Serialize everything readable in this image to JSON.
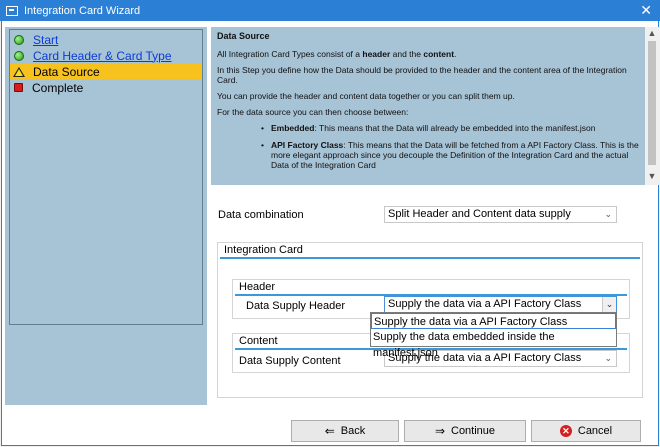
{
  "window": {
    "title": "Integration Card Wizard",
    "close_glyph": "✕"
  },
  "steps": [
    {
      "label": "Start",
      "state": "done",
      "icon": "green-dot-icon"
    },
    {
      "label": "Card Header & Card Type",
      "state": "done",
      "icon": "green-dot-icon"
    },
    {
      "label": "Data Source",
      "state": "current",
      "icon": "warning-icon"
    },
    {
      "label": "Complete",
      "state": "pending",
      "icon": "red-square-icon"
    }
  ],
  "info": {
    "heading": "Data Source",
    "p1_pre": "All Integration Card Types consist of a ",
    "p1_b1": "header",
    "p1_mid": " and the ",
    "p1_b2": "content",
    "p1_end": ".",
    "p2": "In this Step you define how the Data should be provided to the header and the content area of the Integration Card.",
    "p3": "You can provide the header and content data together or you can split them up.",
    "p4": "For the data source you can then choose between:",
    "bullet1_b": "Embedded",
    "bullet1": ": This means that the Data will already be embedded into the manifest.json",
    "bullet2_b": "API Factory Class",
    "bullet2": ": This means that the Data will be fetched from a API Factory Class. This is the more elegant approach since you decouple the Definition of the Integration Card and the actual Data of the Integration Card"
  },
  "form": {
    "data_combination_label": "Data combination",
    "data_combination_value": "Split Header and Content data supply",
    "integration_card_title": "Integration Card",
    "header_group_title": "Header",
    "data_supply_header_label": "Data Supply Header",
    "data_supply_header_value": "Supply the data via a API Factory Class",
    "header_options": [
      "Supply the data via a API Factory Class",
      "Supply the data embedded inside the manifest.json"
    ],
    "content_group_title": "Content",
    "data_supply_content_label": "Data Supply Content",
    "data_supply_content_value": "Supply the data via a API Factory Class"
  },
  "buttons": {
    "back": "Back",
    "continue": "Continue",
    "cancel": "Cancel"
  },
  "colors": {
    "titlebar": "#2b7fd4",
    "panel": "#a7c3d6",
    "active_step": "#f7c21e",
    "group_line": "#3a9ad9"
  }
}
